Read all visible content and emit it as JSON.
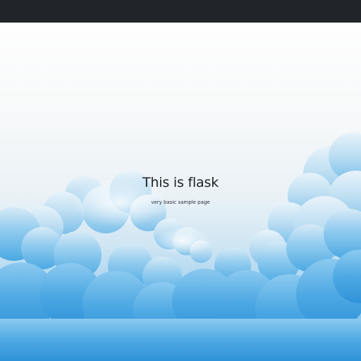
{
  "hero": {
    "title": "This is flask",
    "subtitle": "very basic sample page"
  }
}
